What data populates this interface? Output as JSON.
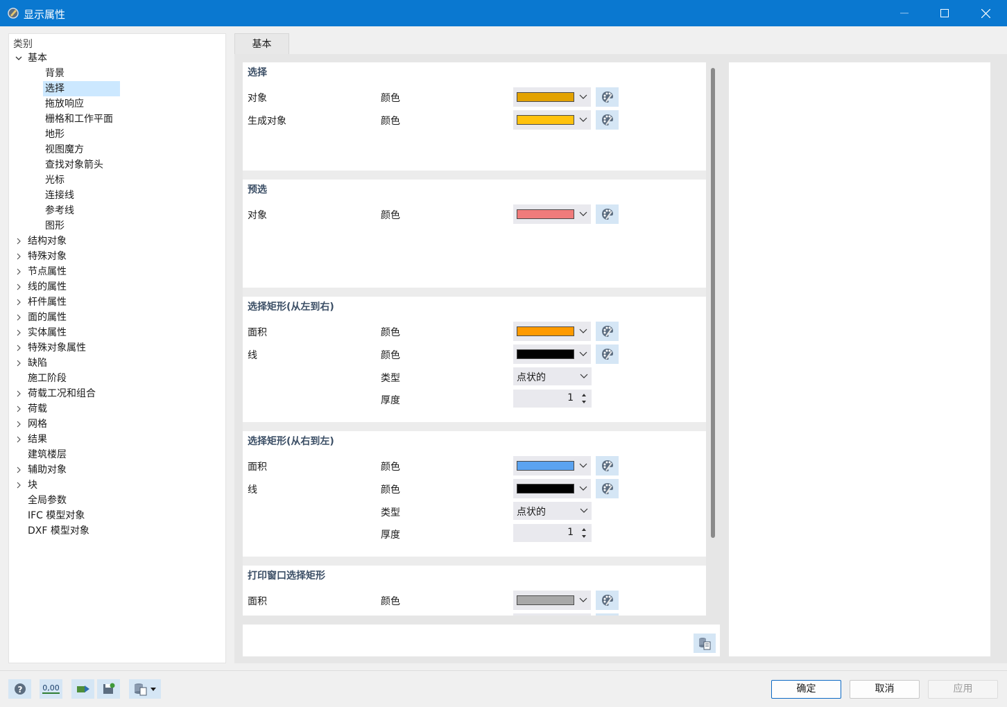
{
  "window": {
    "title": "显示属性",
    "icon": "app-icon",
    "controls": [
      "minimize-icon",
      "maximize-icon",
      "close-icon"
    ]
  },
  "tree": {
    "header": "类别",
    "items": [
      {
        "label": "基本",
        "expanded": true,
        "children": [
          "背景",
          "选择",
          "拖放响应",
          "栅格和工作平面",
          "地形",
          "视图魔方",
          "查找对象箭头",
          "光标",
          "连接线",
          "参考线",
          "图形"
        ]
      },
      {
        "label": "结构对象",
        "expandable": true
      },
      {
        "label": "特殊对象",
        "expandable": true
      },
      {
        "label": "节点属性",
        "expandable": true
      },
      {
        "label": "线的属性",
        "expandable": true
      },
      {
        "label": "杆件属性",
        "expandable": true
      },
      {
        "label": "面的属性",
        "expandable": true
      },
      {
        "label": "实体属性",
        "expandable": true
      },
      {
        "label": "特殊对象属性",
        "expandable": true
      },
      {
        "label": "缺陷",
        "expandable": true
      },
      {
        "label": "施工阶段",
        "expandable": false
      },
      {
        "label": "荷载工况和组合",
        "expandable": true
      },
      {
        "label": "荷载",
        "expandable": true
      },
      {
        "label": "网格",
        "expandable": true
      },
      {
        "label": "结果",
        "expandable": true
      },
      {
        "label": "建筑楼层",
        "expandable": false
      },
      {
        "label": "辅助对象",
        "expandable": true
      },
      {
        "label": "块",
        "expandable": true
      },
      {
        "label": "全局参数",
        "expandable": false
      },
      {
        "label": "IFC 模型对象",
        "expandable": false
      },
      {
        "label": "DXF 模型对象",
        "expandable": false
      }
    ],
    "selected": "选择"
  },
  "tab": {
    "label": "基本"
  },
  "sections": [
    {
      "title": "选择",
      "rows": [
        {
          "label": "对象",
          "prop": "颜色",
          "kind": "color",
          "color": "#e3a200"
        },
        {
          "label": "生成对象",
          "prop": "颜色",
          "kind": "color",
          "color": "#ffc20e"
        }
      ]
    },
    {
      "title": "预选",
      "rows": [
        {
          "label": "对象",
          "prop": "颜色",
          "kind": "color",
          "color": "#f07b7b"
        }
      ]
    },
    {
      "title": "选择矩形(从左到右)",
      "rows": [
        {
          "label": "面积",
          "prop": "颜色",
          "kind": "color",
          "color": "#ff9a00"
        },
        {
          "label": "线",
          "prop": "颜色",
          "kind": "color",
          "color": "#000000"
        },
        {
          "label": "",
          "prop": "类型",
          "kind": "select",
          "value": "点状的"
        },
        {
          "label": "",
          "prop": "厚度",
          "kind": "spin",
          "value": "1"
        }
      ]
    },
    {
      "title": "选择矩形(从右到左)",
      "rows": [
        {
          "label": "面积",
          "prop": "颜色",
          "kind": "color",
          "color": "#5ba3f0"
        },
        {
          "label": "线",
          "prop": "颜色",
          "kind": "color",
          "color": "#000000"
        },
        {
          "label": "",
          "prop": "类型",
          "kind": "select",
          "value": "点状的"
        },
        {
          "label": "",
          "prop": "厚度",
          "kind": "spin",
          "value": "1"
        }
      ]
    },
    {
      "title": "打印窗口选择矩形",
      "rows": [
        {
          "label": "面积",
          "prop": "颜色",
          "kind": "color",
          "color": "#a8a8a8"
        },
        {
          "label": "",
          "prop": "",
          "kind": "color-partial",
          "color": ""
        }
      ]
    }
  ],
  "footer": {
    "tools": [
      "help-icon",
      "decimal-places-icon",
      "export-icon",
      "save-settings-icon",
      "database-menu-icon"
    ],
    "decimal_label": "0,00",
    "ok": "确定",
    "cancel": "取消",
    "apply": "应用"
  }
}
